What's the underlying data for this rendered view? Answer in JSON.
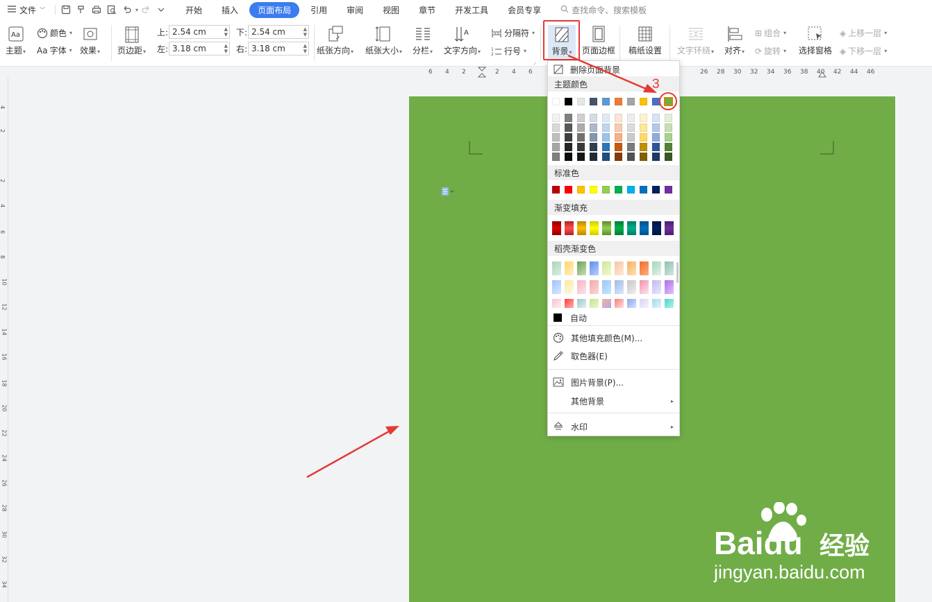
{
  "menubar": {
    "file_label": "文件",
    "tabs": [
      {
        "label": "开始",
        "active": false
      },
      {
        "label": "插入",
        "active": false
      },
      {
        "label": "页面布局",
        "active": true
      },
      {
        "label": "引用",
        "active": false
      },
      {
        "label": "审阅",
        "active": false
      },
      {
        "label": "视图",
        "active": false
      },
      {
        "label": "章节",
        "active": false
      },
      {
        "label": "开发工具",
        "active": false
      },
      {
        "label": "会员专享",
        "active": false
      }
    ],
    "search_placeholder": "查找命令、搜索模板"
  },
  "ribbon": {
    "theme": "主题",
    "colors": "颜色",
    "font": "字体",
    "effects": "效果",
    "margins": "页边距",
    "margin_top_label": "上:",
    "margin_top_value": "2.54 cm",
    "margin_bottom_label": "下:",
    "margin_bottom_value": "2.54 cm",
    "margin_left_label": "左:",
    "margin_left_value": "3.18 cm",
    "margin_right_label": "右:",
    "margin_right_value": "3.18 cm",
    "orientation": "纸张方向",
    "size": "纸张大小",
    "columns": "分栏",
    "text_direction": "文字方向",
    "breaks": "分隔符",
    "line_numbers": "行号",
    "background": "背景",
    "page_border": "页面边框",
    "manuscript": "稿纸设置",
    "text_wrap": "文字环绕",
    "align": "对齐",
    "group": "组合",
    "rotate": "旋转",
    "selection_pane": "选择窗格",
    "bring_forward": "上移一层",
    "send_backward": "下移一层"
  },
  "hruler_numbers": [
    "6",
    "4",
    "2",
    "2",
    "4",
    "6",
    "26",
    "28",
    "30",
    "32",
    "34",
    "36",
    "38",
    "40",
    "42",
    "44",
    "46"
  ],
  "vruler_numbers": [
    "4",
    "2",
    "2",
    "4",
    "6",
    "8",
    "10",
    "12",
    "14",
    "16",
    "18",
    "20",
    "22",
    "24",
    "26",
    "28",
    "30",
    "32",
    "34"
  ],
  "page": {
    "background_color": "#70ad47"
  },
  "dropdown": {
    "remove_background": "删除页面背景",
    "theme_colors_header": "主题颜色",
    "theme_colors": [
      "#ffffff",
      "#000000",
      "#e7e6e6",
      "#44546a",
      "#5b9bd5",
      "#ed7d31",
      "#a5a5a5",
      "#ffc000",
      "#4472c4",
      "#70ad47"
    ],
    "theme_shades": [
      [
        "#f2f2f2",
        "#808080",
        "#d0cece",
        "#d6dce5",
        "#deebf7",
        "#fbe5d6",
        "#ededed",
        "#fff2cc",
        "#dae3f3",
        "#e2f0d9"
      ],
      [
        "#d9d9d9",
        "#595959",
        "#aeabab",
        "#adb9ca",
        "#bdd7ee",
        "#f8cbad",
        "#dbdbdb",
        "#ffe699",
        "#b4c7e7",
        "#c5e0b4"
      ],
      [
        "#bfbfbf",
        "#404040",
        "#757171",
        "#8497b0",
        "#9dc3e6",
        "#f4b183",
        "#c9c9c9",
        "#ffd966",
        "#8faadc",
        "#a9d18e"
      ],
      [
        "#a6a6a6",
        "#262626",
        "#3b3838",
        "#333f50",
        "#2e75b6",
        "#c55a11",
        "#7b7b7b",
        "#bf9000",
        "#2f5597",
        "#548235"
      ],
      [
        "#7f7f7f",
        "#0d0d0d",
        "#171616",
        "#222a35",
        "#1f4e79",
        "#843c0c",
        "#525252",
        "#7f6000",
        "#203864",
        "#385723"
      ]
    ],
    "standard_colors_header": "标准色",
    "standard_colors": [
      "#c00000",
      "#ff0000",
      "#ffc000",
      "#ffff00",
      "#92d050",
      "#00b050",
      "#00b0f0",
      "#0070c0",
      "#002060",
      "#7030a0"
    ],
    "gradient_fill_header": "渐变填充",
    "gradient_colors": [
      [
        "#8b0000",
        "#e00000"
      ],
      [
        "#b22222",
        "#ff5050"
      ],
      [
        "#b8860b",
        "#ffc000"
      ],
      [
        "#cccc00",
        "#ffff00"
      ],
      [
        "#5c8a2a",
        "#92d050"
      ],
      [
        "#007a37",
        "#00b050"
      ],
      [
        "#007a6a",
        "#00b08a"
      ],
      [
        "#00508c",
        "#0070c0"
      ],
      [
        "#001540",
        "#002060"
      ],
      [
        "#4b1e70",
        "#7030a0"
      ]
    ],
    "wps_gradient_header": "稻壳渐变色",
    "wps_gradients": [
      [
        [
          "#a8d5ba",
          "#dcefe3"
        ],
        [
          "#ffd66b",
          "#fff1c1"
        ],
        [
          "#6f9e5a",
          "#c5e0b4"
        ],
        [
          "#5b8def",
          "#b9d0ff"
        ],
        [
          "#c9e7a5",
          "#f6f9c8"
        ],
        [
          "#f7c6a3",
          "#fde8d8"
        ],
        [
          "#f9b15b",
          "#fde0b8"
        ],
        [
          "#f26b2b",
          "#fbb07c"
        ],
        [
          "#a2d9b7",
          "#e1f3e8"
        ],
        [
          "#8fbfb0",
          "#cfe7df"
        ]
      ],
      [
        [
          "#9cc3ff",
          "#dbe9ff"
        ],
        [
          "#f9e8a0",
          "#fffbe3"
        ],
        [
          "#f6b4c8",
          "#fde2ea"
        ],
        [
          "#f4a7a7",
          "#fdd8d8"
        ],
        [
          "#a1c4fd",
          "#c2e9fb"
        ],
        [
          "#9ebbe6",
          "#dbe8fa"
        ],
        [
          "#c6c6c6",
          "#f0f0f0"
        ],
        [
          "#f48fb1",
          "#fce4ec"
        ],
        [
          "#c1b9f0",
          "#ebe7fd"
        ],
        [
          "#b06ce8",
          "#e0c3fc"
        ]
      ],
      [
        [
          "#f6c4d0",
          "#fdeef2"
        ],
        [
          "#ff3b3b",
          "#ffb0b0"
        ],
        [
          "#9ec7c4",
          "#dff1ef"
        ],
        [
          "#c7e08b",
          "#edf6d2"
        ],
        [
          "#f2b2a8",
          "#b8a7d9"
        ],
        [
          "#ff7a7a",
          "#fde2e2"
        ],
        [
          "#8aa9e6",
          "#d6e2fb"
        ],
        [
          "#d9d3f3",
          "#f5f3fd"
        ],
        [
          "#a6d8ef",
          "#e3f4fb"
        ],
        [
          "#4fd1c5",
          "#b2f5ea"
        ]
      ]
    ],
    "auto": "自动",
    "more_fill_colors": "其他填充颜色(M)...",
    "eyedropper": "取色器(E)",
    "picture_background": "图片背景(P)...",
    "other_background": "其他背景",
    "watermark": "水印"
  },
  "annotation": {
    "step_number": "3",
    "accent_color": "#e53935"
  },
  "watermark": {
    "brand": "Baidu",
    "brand_cn": "经验",
    "url": "jingyan.baidu.com"
  }
}
